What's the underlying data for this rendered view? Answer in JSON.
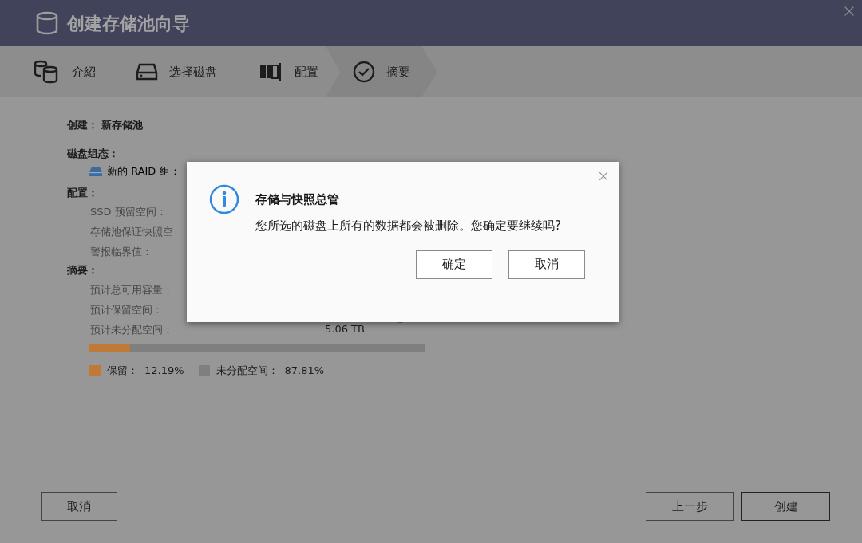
{
  "window": {
    "title": "创建存储池向导"
  },
  "steps": [
    {
      "label": "介紹",
      "selected": false
    },
    {
      "label": "选择磁盘",
      "selected": false
    },
    {
      "label": "配置",
      "selected": false
    },
    {
      "label": "摘要",
      "selected": true
    }
  ],
  "create": {
    "label": "创建：",
    "value": "新存储池"
  },
  "disk_config": {
    "label": "磁盘组态：",
    "items": [
      {
        "label": "新的 RAID 组："
      }
    ]
  },
  "config": {
    "label": "配置：",
    "items": [
      {
        "label": "SSD 预留空间："
      },
      {
        "label": "存储池保证快照空"
      },
      {
        "label": "警报临界值："
      }
    ]
  },
  "summary": {
    "label": "摘要：",
    "items": [
      {
        "label": "预计总可用容量："
      },
      {
        "label": "预计保留空间："
      },
      {
        "label": "预计未分配空间：",
        "value": "5.06 TB"
      }
    ],
    "usage": {
      "level": 0.1219,
      "legend": [
        {
          "label": "保留：",
          "value": "12.19%",
          "color": "#c07a38"
        },
        {
          "label": "未分配空间：",
          "value": "87.81%",
          "color": "#7f7f7f"
        }
      ]
    }
  },
  "dialog": {
    "title": "存储与快照总管",
    "message": "您所选的磁盘上所有的数据都会被删除。您确定要继续吗?",
    "buttons": [
      "确定",
      "取消"
    ]
  },
  "footer": {
    "left": [
      "取消"
    ],
    "right": [
      "上一步",
      "创建"
    ]
  }
}
